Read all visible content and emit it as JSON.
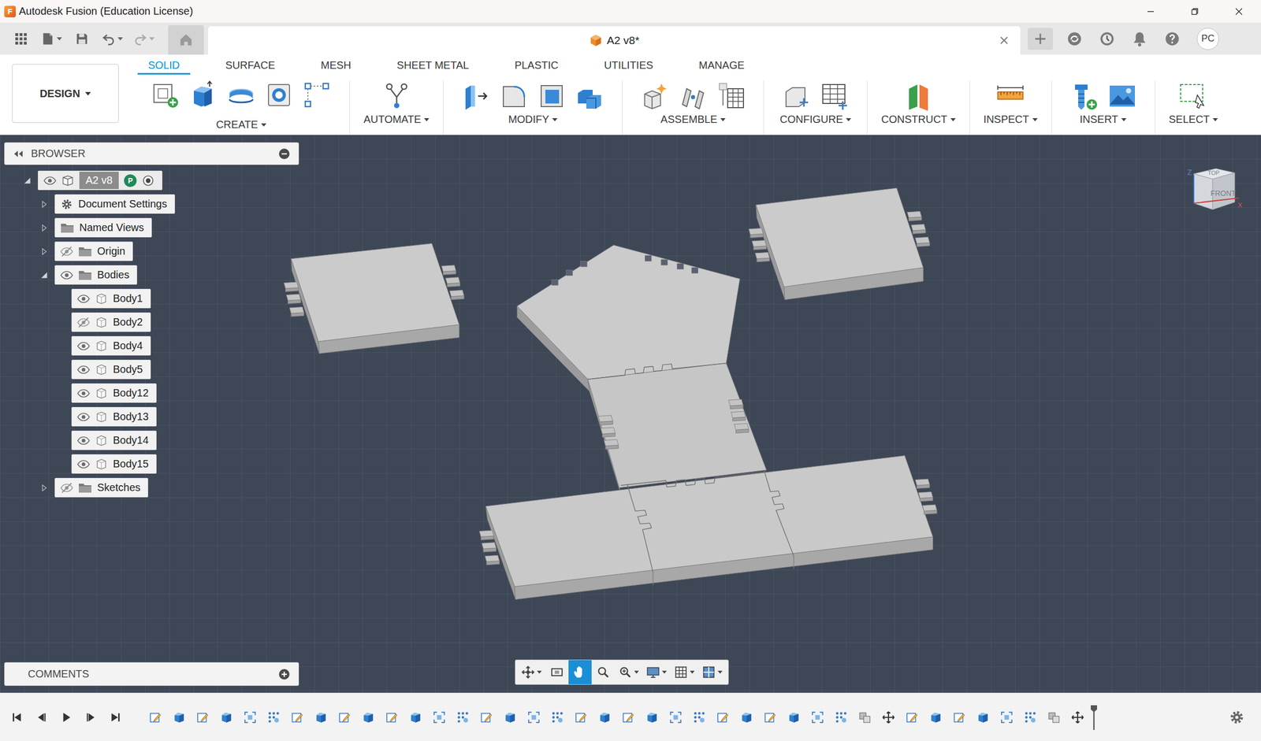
{
  "window": {
    "title": "Autodesk Fusion (Education License)",
    "logo": "F"
  },
  "document_tab": {
    "title": "A2 v8*"
  },
  "account": {
    "initials": "PC"
  },
  "workspace": {
    "label": "DESIGN"
  },
  "tabs": [
    {
      "label": "SOLID",
      "selected": true
    },
    {
      "label": "SURFACE",
      "selected": false
    },
    {
      "label": "MESH",
      "selected": false
    },
    {
      "label": "SHEET METAL",
      "selected": false
    },
    {
      "label": "PLASTIC",
      "selected": false
    },
    {
      "label": "UTILITIES",
      "selected": false
    },
    {
      "label": "MANAGE",
      "selected": false
    }
  ],
  "groups": [
    {
      "label": "CREATE",
      "tools": [
        "sketch",
        "extrude",
        "revolve",
        "hole",
        "pattern"
      ]
    },
    {
      "label": "AUTOMATE",
      "tools": [
        "automate"
      ]
    },
    {
      "label": "MODIFY",
      "tools": [
        "pushpull",
        "fillet",
        "shell",
        "combine"
      ]
    },
    {
      "label": "ASSEMBLE",
      "tools": [
        "component",
        "joint",
        "table"
      ]
    },
    {
      "label": "CONFIGURE",
      "tools": [
        "config",
        "configtable"
      ]
    },
    {
      "label": "CONSTRUCT",
      "tools": [
        "plane"
      ]
    },
    {
      "label": "INSPECT",
      "tools": [
        "measure"
      ]
    },
    {
      "label": "INSERT",
      "tools": [
        "insert",
        "image"
      ]
    },
    {
      "label": "SELECT",
      "tools": [
        "select"
      ]
    }
  ],
  "browser": {
    "title": "BROWSER",
    "root": {
      "label": "A2 v8",
      "badge": "P",
      "expanded": true,
      "visible": true,
      "active": true
    },
    "items": [
      {
        "label": "Document Settings",
        "kind": "settings",
        "expanded": false
      },
      {
        "label": "Named Views",
        "kind": "views",
        "expanded": false
      },
      {
        "label": "Origin",
        "kind": "folder",
        "expanded": false,
        "visible": false
      },
      {
        "label": "Bodies",
        "kind": "folder",
        "expanded": true,
        "visible": true,
        "children": [
          {
            "label": "Body1",
            "kind": "body",
            "visible": true
          },
          {
            "label": "Body2",
            "kind": "body",
            "visible": false
          },
          {
            "label": "Body4",
            "kind": "body",
            "visible": true
          },
          {
            "label": "Body5",
            "kind": "body",
            "visible": true
          },
          {
            "label": "Body12",
            "kind": "body",
            "visible": true
          },
          {
            "label": "Body13",
            "kind": "body",
            "visible": true
          },
          {
            "label": "Body14",
            "kind": "body",
            "visible": true
          },
          {
            "label": "Body15",
            "kind": "body",
            "visible": true
          }
        ]
      },
      {
        "label": "Sketches",
        "kind": "folder",
        "expanded": false,
        "visible": false
      }
    ]
  },
  "viewcube": {
    "top": "TOP",
    "front": "FRONT",
    "axes": [
      "Z",
      "X"
    ]
  },
  "comments": {
    "title": "COMMENTS"
  },
  "nav_tools": [
    {
      "kind": "orbit",
      "selected": false,
      "dropdown": true
    },
    {
      "kind": "look",
      "selected": false,
      "dropdown": false
    },
    {
      "kind": "pan",
      "selected": true,
      "dropdown": false
    },
    {
      "kind": "zoom",
      "selected": false,
      "dropdown": false
    },
    {
      "kind": "zoomwindow",
      "selected": false,
      "dropdown": true
    },
    {
      "kind": "display",
      "selected": false,
      "dropdown": true
    },
    {
      "kind": "grid",
      "selected": false,
      "dropdown": true
    },
    {
      "kind": "viewports",
      "selected": false,
      "dropdown": true
    }
  ],
  "timeline": {
    "features": [
      "sketch",
      "extrude",
      "sketch",
      "extrude",
      "move",
      "pattern",
      "sketch",
      "extrude",
      "sketch",
      "extrude",
      "sketch",
      "extrude",
      "move",
      "pattern",
      "sketch",
      "extrude",
      "move",
      "pattern",
      "sketch",
      "extrude",
      "sketch",
      "extrude",
      "move",
      "pattern",
      "sketch",
      "extrude",
      "sketch",
      "extrude",
      "move",
      "pattern",
      "combine",
      "transform",
      "sketch",
      "extrude",
      "sketch",
      "extrude",
      "move",
      "pattern",
      "combine",
      "transform"
    ]
  }
}
